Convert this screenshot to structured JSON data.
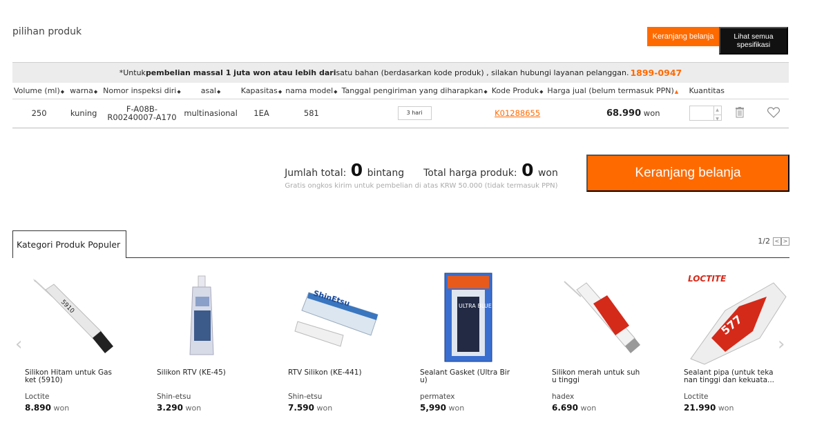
{
  "page": {
    "section_title": "pilihan produk",
    "cart_small_label": "Keranjang belanja",
    "spec_label": "Lihat semua spesifikasi"
  },
  "notice": {
    "prefix": "*Untuk ",
    "bold": "pembelian massal 1 juta won atau lebih dari",
    "middle": " satu bahan (berdasarkan kode produk)  , silakan hubungi layanan pelanggan. ",
    "phone": "1899-0947"
  },
  "table": {
    "headers": {
      "volume": "Volume (ml)",
      "warna": "warna",
      "nomor": "Nomor inspeksi diri",
      "asal": "asal",
      "kapasitas": "Kapasitas",
      "model": "nama model",
      "tanggal": "Tanggal pengiriman yang diharapkan",
      "kode": "Kode Produk",
      "harga": "Harga jual (belum termasuk PPN)",
      "kuantitas": "Kuantitas"
    },
    "row": {
      "volume": "250",
      "warna": "kuning",
      "nomor": "F-A08B-R00240007-A170",
      "asal": "multinasional",
      "kapasitas": "1EA",
      "model": "581",
      "tanggal": "3 hari",
      "kode": "K01288655",
      "harga": "68.990",
      "currency": "won"
    }
  },
  "summary": {
    "total_label": "Jumlah total:",
    "total_value": "0",
    "total_unit": "bintang",
    "price_label": "Total harga produk:",
    "price_value": "0",
    "price_unit": "won",
    "shipping_note": "Gratis ongkos kirim untuk pembelian di atas KRW 50.000 (tidak termasuk PPN)",
    "cart_button": "Keranjang belanja"
  },
  "category": {
    "tab_label": "Kategori Produk Populer",
    "pager": "1/2",
    "products": [
      {
        "name": "Silikon Hitam untuk Gas ket (5910)",
        "brand": "Loctite",
        "price": "8.890",
        "currency": "won"
      },
      {
        "name": "Silikon RTV (KE-45)",
        "brand": "Shin-etsu",
        "price": "3.290",
        "currency": "won"
      },
      {
        "name": "RTV Silikon (KE-441)",
        "brand": "Shin-etsu",
        "price": "7.590",
        "currency": "won"
      },
      {
        "name": "Sealant Gasket (Ultra Bir u)",
        "brand": "permatex",
        "price": "5,990",
        "currency": "won"
      },
      {
        "name": "Silikon merah untuk suh u tinggi",
        "brand": "hadex",
        "price": "6.690",
        "currency": "won"
      },
      {
        "name": "Sealant pipa (untuk teka nan tinggi dan kekuata...",
        "brand": "Loctite",
        "price": "21.990",
        "currency": "won"
      }
    ],
    "image_labels": {
      "p0": "5910",
      "p2": "ShinEtsu",
      "p3": "ULTRA BLUE",
      "p5_brand": "LOCTITE",
      "p5_num": "577"
    }
  }
}
